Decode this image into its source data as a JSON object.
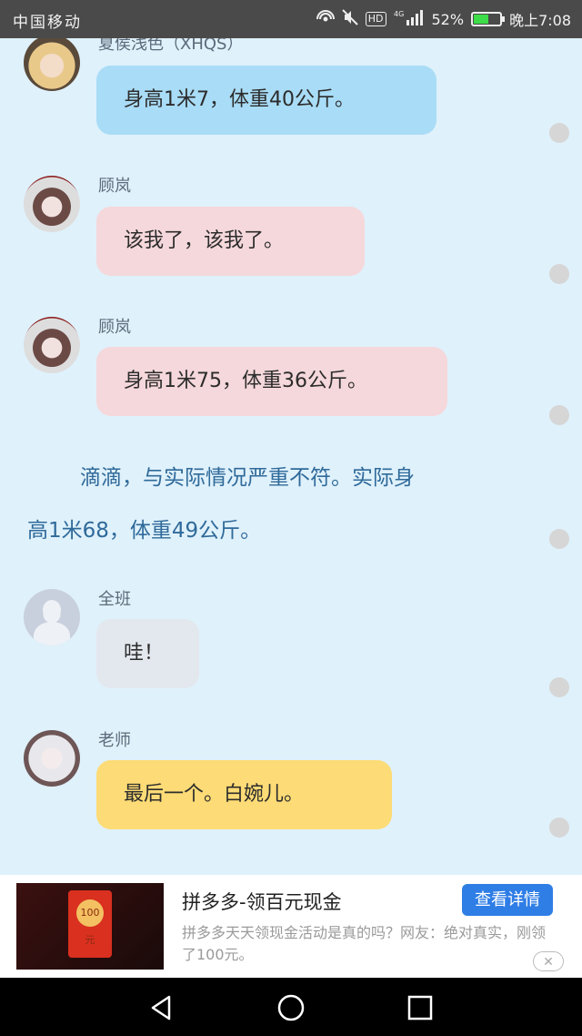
{
  "status_bar": {
    "carrier": "中国移动",
    "hd": "HD",
    "network": "4G",
    "battery": "52%",
    "battery_level": 0.52,
    "time": "晚上7:08"
  },
  "messages": [
    {
      "name": "夏侯浅色（XHQS）",
      "text": "身高1米7，体重40公斤。",
      "avatar": "avatar-xiahou",
      "bubble_color": "#a9dcf6"
    },
    {
      "name": "顾岚",
      "text": "该我了，该我了。",
      "avatar": "avatar-gulan",
      "bubble_color": "#f5d8db"
    },
    {
      "name": "顾岚",
      "text": "身高1米75，体重36公斤。",
      "avatar": "avatar-gulan",
      "bubble_color": "#f5d8db"
    },
    {
      "name": "全班",
      "text": "哇！",
      "avatar": "avatar-default",
      "bubble_color": "#e3e7ee"
    },
    {
      "name": "老师",
      "text": "最后一个。白婉儿。",
      "avatar": "avatar-teacher",
      "bubble_color": "#fddb76"
    }
  ],
  "narration": {
    "line1": "滴滴，与实际情况严重不符。实际身",
    "line2": "高1米68，体重49公斤。"
  },
  "ad": {
    "title": "拼多多-领百元现金",
    "button": "查看详情",
    "description": "拼多多天天领现金活动是真的吗？网友：绝对真实，刚领了100元。",
    "image_text": "100元",
    "close": "✕"
  }
}
